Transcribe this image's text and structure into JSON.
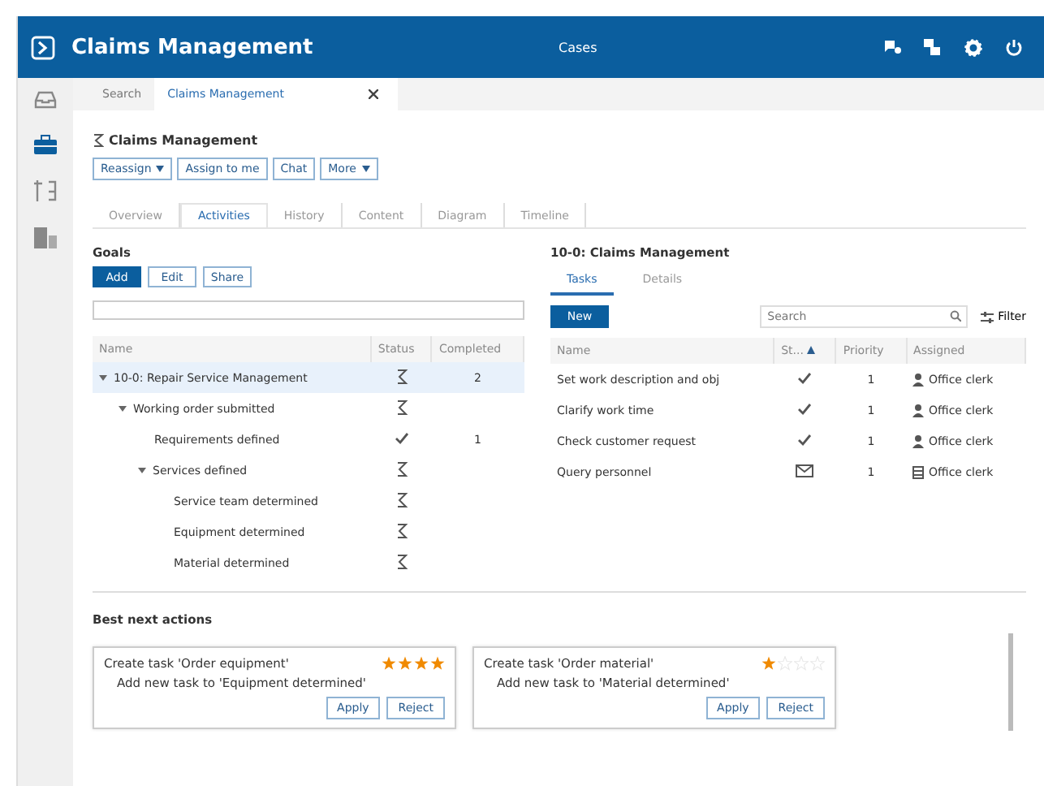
{
  "app_bar": {
    "title": "Claims Management",
    "section": "Cases"
  },
  "open_tabs": [
    {
      "label": "Search",
      "selected": false,
      "closable": false
    },
    {
      "label": "Claims Management",
      "selected": true,
      "closable": true
    }
  ],
  "case": {
    "title": "Claims Management",
    "actions": [
      {
        "label": "Reassign",
        "dropdown": true
      },
      {
        "label": "Assign to me",
        "dropdown": false
      },
      {
        "label": "Chat",
        "dropdown": false
      },
      {
        "label": "More",
        "dropdown": true
      }
    ]
  },
  "sub_tabs": [
    {
      "label": "Overview",
      "selected": false
    },
    {
      "label": "Activities",
      "selected": true
    },
    {
      "label": "History",
      "selected": false
    },
    {
      "label": "Content",
      "selected": false
    },
    {
      "label": "Diagram",
      "selected": false
    },
    {
      "label": "Timeline",
      "selected": false
    }
  ],
  "goals": {
    "title": "Goals",
    "buttons": [
      {
        "label": "Add",
        "primary": true
      },
      {
        "label": "Edit",
        "primary": false
      },
      {
        "label": "Share",
        "primary": false
      }
    ],
    "columns": [
      "Name",
      "Status",
      "Completed"
    ],
    "rows": [
      {
        "name": "10-0: Repair Service Management",
        "done": false,
        "completed": "2",
        "selected": true,
        "expanded": true,
        "children": [
          {
            "name": "Working order submitted",
            "done": false,
            "selected": false,
            "expanded": true,
            "children": [
              {
                "name": "Requirements defined",
                "done": true,
                "completed": "1",
                "selected": false
              },
              {
                "name": "Services defined",
                "done": false,
                "selected": false,
                "expanded": true,
                "children": [
                  {
                    "name": "Service team determined",
                    "done": false,
                    "selected": false
                  },
                  {
                    "name": "Equipment determined",
                    "done": false,
                    "selected": false
                  },
                  {
                    "name": "Material determined",
                    "done": false,
                    "selected": false
                  }
                ]
              }
            ]
          }
        ]
      }
    ]
  },
  "tasks": {
    "title": "10-0: Claims Management",
    "tabs": [
      {
        "label": "Tasks",
        "selected": true
      },
      {
        "label": "Details",
        "selected": false
      }
    ],
    "new_button": "New",
    "search": {
      "placeholder": "Search"
    },
    "filter": "Filter",
    "columns": [
      "Name",
      "St...",
      "Priority",
      "Assigned"
    ],
    "rows": [
      {
        "kind": "done",
        "name": "Set work description and obj",
        "priority": "1",
        "group": false,
        "assigned": "Office clerk"
      },
      {
        "kind": "done",
        "name": "Clarify work time",
        "priority": "1",
        "group": false,
        "assigned": "Office clerk"
      },
      {
        "kind": "done",
        "name": "Check customer request",
        "priority": "1",
        "group": false,
        "assigned": "Office clerk"
      },
      {
        "kind": "queued",
        "name": "Query personnel",
        "priority": "1",
        "group": true,
        "assigned": "Office clerk"
      }
    ]
  },
  "best_next_actions": {
    "title": "Best next actions",
    "cards": [
      {
        "title": "Create task 'Order equipment'",
        "stars": 4,
        "description": "Add new task to 'Equipment determined'",
        "buttons": [
          "Apply",
          "Reject"
        ]
      },
      {
        "title": "Create task 'Order material'",
        "stars": 1,
        "description": "Add new task to 'Material determined'",
        "buttons": [
          "Apply",
          "Reject"
        ]
      }
    ]
  }
}
